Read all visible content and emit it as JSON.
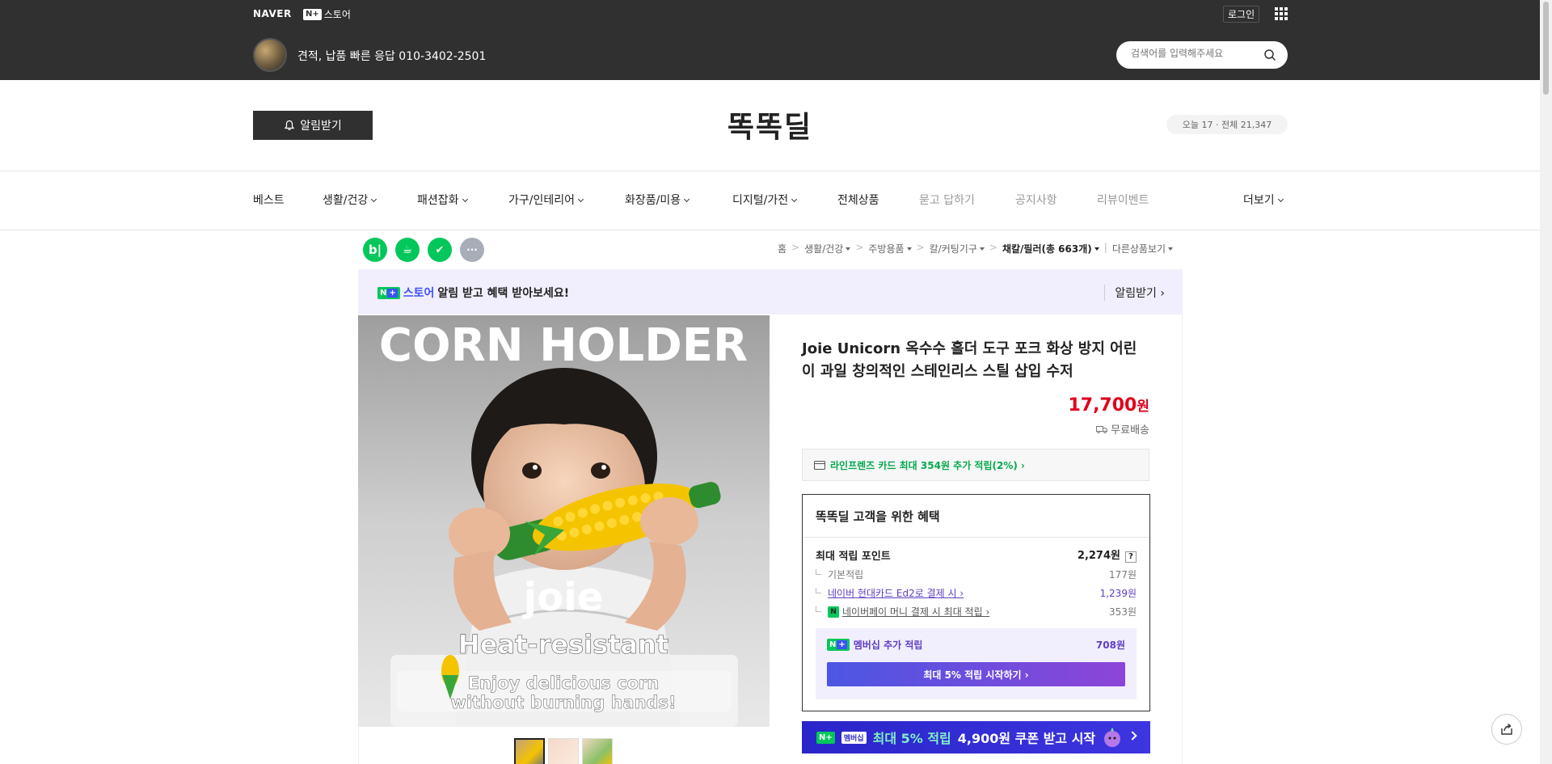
{
  "topbar": {
    "naver_label": "NAVER",
    "store_badge": "N+",
    "store_label": "스토어",
    "login_label": "로그인",
    "shop_description": "견적, 납품 빠른 응답 010-3402-2501",
    "search_placeholder": "검색어를 입력해주세요"
  },
  "store": {
    "alarm_label": "알림받기",
    "title": "똑똑딜",
    "visit_count": "오늘 17 · 전체 21,347"
  },
  "nav": {
    "items": [
      {
        "label": "베스트"
      },
      {
        "label": "생활/건강"
      },
      {
        "label": "패션잡화"
      },
      {
        "label": "가구/인테리어"
      },
      {
        "label": "화장품/미용"
      },
      {
        "label": "디지털/가전"
      },
      {
        "label": "전체상품"
      },
      {
        "label": "묻고 답하기"
      },
      {
        "label": "공지사항"
      },
      {
        "label": "리뷰이벤트"
      }
    ],
    "more_label": "더보기"
  },
  "icons": {
    "blog_glyph": "b|",
    "talk_glyph": "☕",
    "bookmark_glyph": "✔",
    "more_glyph": "···"
  },
  "breadcrumb": {
    "items": [
      "홈",
      "생활/건강",
      "주방용품",
      "칼/커팅기구",
      "채칼/필러(총 663개)",
      "다른상품보기"
    ]
  },
  "promo": {
    "store_label": "스토어",
    "message": "알림 받고 혜택 받아보세요!",
    "action": "알림받기 ›"
  },
  "product": {
    "image_text_top": "CORN HOLDER",
    "image_text_brand": "joie",
    "image_text_heat": "Heat-resistant",
    "image_text_line1": "Enjoy delicious corn",
    "image_text_line2": "without burning hands!",
    "title": "Joie Unicorn 옥수수 홀더 도구 포크 화상 방지 어린이 과일 창의적인 스테인리스 스틸 삽입 수저",
    "price_number": "17,700",
    "price_unit": "원",
    "shipping": "무료배송",
    "card_benefit": "라인프렌즈 카드 최대 354원 추가 적립(2%) ›"
  },
  "benefits": {
    "title": "똑똑딜 고객을 위한 혜택",
    "max_points_label": "최대 적립 포인트",
    "max_points_value": "2,274원",
    "help": "?",
    "basic_label": "기본적립",
    "basic_value": "177원",
    "hyundai_label": "네이버 현대카드 Ed2로 결제 시 ›",
    "hyundai_value": "1,239원",
    "npay_icon": "N",
    "npay_label": "네이버페이 머니 결제 시 최대 적립 ›",
    "npay_value": "353원",
    "membership_label": "멤버십 추가 적립",
    "membership_value": "708원",
    "membership_cta": "최대 5% 적립 시작하기 ›"
  },
  "coupon_banner": {
    "badge": "N+",
    "badge_sub": "멤버십",
    "highlight": "최대 5% 적립",
    "rest": "4,900원 쿠폰 받고 시작"
  },
  "colors": {
    "header_bg": "#303030",
    "price": "#e0001c",
    "naver_green": "#03c75a",
    "plus_blue": "#3f51ff",
    "promo_bg": "#f1effd"
  }
}
